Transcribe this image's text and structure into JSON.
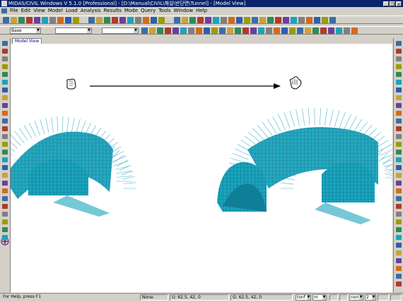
{
  "window": {
    "title": "MIDAS/CIVIL Windows V 5.1.0 [Professional] - [D:\\Manual\\CIVIL\\해설\\반단면\\Tunnel] - [Model View]",
    "minimize_glyph": "_",
    "restore_glyph": "❐",
    "close_glyph": "×"
  },
  "menu": {
    "items": [
      "File",
      "Edit",
      "View",
      "Model",
      "Load",
      "Analysis",
      "Results",
      "Mode",
      "Query",
      "Tools",
      "Window",
      "Help"
    ]
  },
  "toolbar2": {
    "unit_combo": "Base",
    "combo2": "",
    "combo3": ""
  },
  "tab": {
    "label": "Model View"
  },
  "status": {
    "help": "For Help, press F1",
    "node": "None",
    "ucs": "U: 62.5, 42, 0",
    "global": "G: 62.5, 42, 0",
    "force_unit": "tonf",
    "length_unit": "m",
    "view": "non",
    "number": "2"
  },
  "icons": {
    "hand_start": "hand-cursor-icon",
    "hand_end": "hand-cursor-icon",
    "pan_tool": "pan-icon"
  },
  "colors": {
    "tunnel_mesh": "#1aa3bd",
    "force_vectors": "#4ab3c8",
    "title_bar": "#0a246a"
  }
}
